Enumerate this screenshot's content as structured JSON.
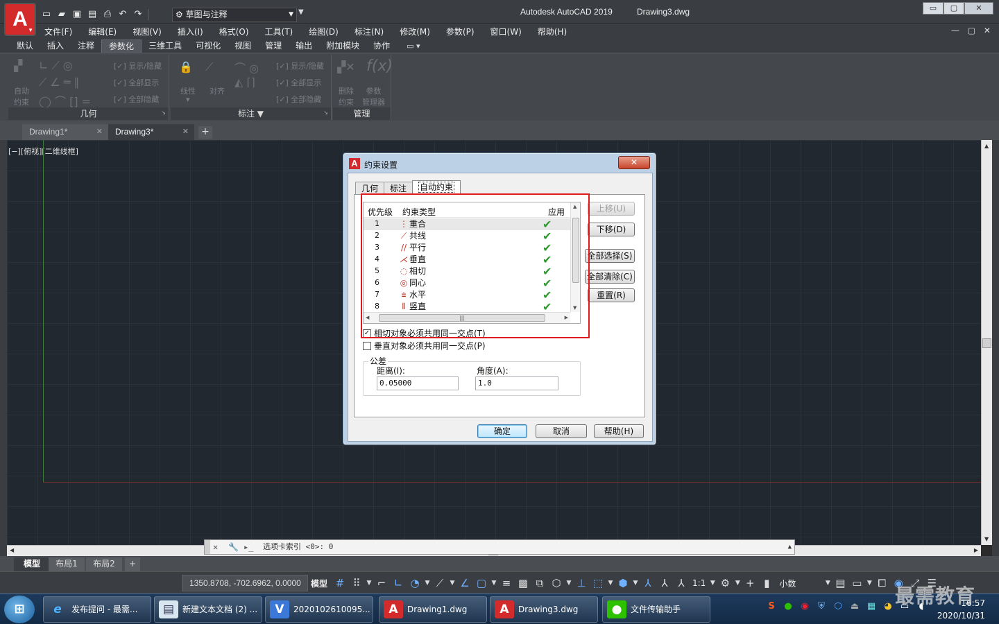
{
  "app": {
    "logo_letter": "A",
    "title": "Autodesk AutoCAD 2019",
    "document": "Drawing3.dwg",
    "workspace": "草图与注释",
    "window_buttons": {
      "minimize": "▭",
      "restore": "▢",
      "close": "✕"
    }
  },
  "menu": [
    "文件(F)",
    "编辑(E)",
    "视图(V)",
    "插入(I)",
    "格式(O)",
    "工具(T)",
    "绘图(D)",
    "标注(N)",
    "修改(M)",
    "参数(P)",
    "窗口(W)",
    "帮助(H)"
  ],
  "ribbon_tabs": {
    "items": [
      "默认",
      "插入",
      "注释",
      "参数化",
      "三维工具",
      "可视化",
      "视图",
      "管理",
      "输出",
      "附加模块",
      "协作"
    ],
    "active_index": 3
  },
  "ribbon_panels": {
    "geometry": {
      "title": "几何",
      "auto_constrain": [
        "自动",
        "约束"
      ],
      "show_hide": "显示/隐藏",
      "show_all": "全部显示",
      "hide_all": "全部隐藏"
    },
    "dimensional": {
      "title": "标注",
      "linear": "线性",
      "aligned": "对齐",
      "show_hide": "显示/隐藏",
      "show_all": "全部显示",
      "hide_all": "全部隐藏"
    },
    "manage": {
      "title": "管理",
      "delete_constraints": [
        "删除",
        "约束"
      ],
      "param_manager": [
        "参数",
        "管理器"
      ]
    }
  },
  "doc_tabs": [
    {
      "label": "Drawing1*",
      "active": false
    },
    {
      "label": "Drawing3*",
      "active": true
    }
  ],
  "viewport_label": "[−][俯视][二维线框]",
  "command_line": {
    "text": "选项卡索引 <0>: 0"
  },
  "layout_tabs": [
    "模型",
    "布局1",
    "布局2"
  ],
  "status_bar": {
    "coordinates": "1350.8708, -702.6962, 0.0000",
    "model": "模型",
    "scale": "1:1",
    "units": "小数"
  },
  "dialog": {
    "title": "约束设置",
    "close_label": "✕",
    "tabs": [
      "几何",
      "标注",
      "自动约束"
    ],
    "active_tab": 2,
    "list_headers": {
      "priority": "优先级",
      "type": "约束类型",
      "apply": "应用"
    },
    "rows": [
      {
        "priority": "1",
        "icon": "coincident-icon",
        "name": "重合",
        "applied": true
      },
      {
        "priority": "2",
        "icon": "collinear-icon",
        "name": "共线",
        "applied": true
      },
      {
        "priority": "3",
        "icon": "parallel-icon",
        "name": "平行",
        "applied": true
      },
      {
        "priority": "4",
        "icon": "perpendicular-icon",
        "name": "垂直",
        "applied": true
      },
      {
        "priority": "5",
        "icon": "tangent-icon",
        "name": "相切",
        "applied": true
      },
      {
        "priority": "6",
        "icon": "concentric-icon",
        "name": "同心",
        "applied": true
      },
      {
        "priority": "7",
        "icon": "horizontal-icon",
        "name": "水平",
        "applied": true
      },
      {
        "priority": "8",
        "icon": "vertical-icon",
        "name": "竖直",
        "applied": true
      }
    ],
    "buttons": {
      "move_up": "上移(U)",
      "move_down": "下移(D)",
      "select_all": "全部选择(S)",
      "clear_all": "全部清除(C)",
      "reset": "重置(R)",
      "ok": "确定",
      "cancel": "取消",
      "help": "帮助(H)"
    },
    "checkbox_tangent": {
      "label": "相切对象必须共用同一交点(T)",
      "checked": true
    },
    "checkbox_perpendicular": {
      "label": "垂直对象必须共用同一交点(P)",
      "checked": false
    },
    "tolerance": {
      "group_label": "公差",
      "distance_label": "距离(I):",
      "distance_value": "0.05000",
      "angle_label": "角度(A):",
      "angle_value": "1.0"
    }
  },
  "taskbar": {
    "items": [
      "发布提问 - 最需...",
      "新建文本文档 (2) ...",
      "2020102610095...",
      "Drawing1.dwg",
      "Drawing3.dwg",
      "文件传输助手"
    ],
    "date": "2020/10/31",
    "time": "16:57"
  },
  "watermark": "最需教育",
  "colors": {
    "highlight": "#e0191c",
    "check": "#2e9a2e",
    "autocad_red": "#d32b2b"
  }
}
